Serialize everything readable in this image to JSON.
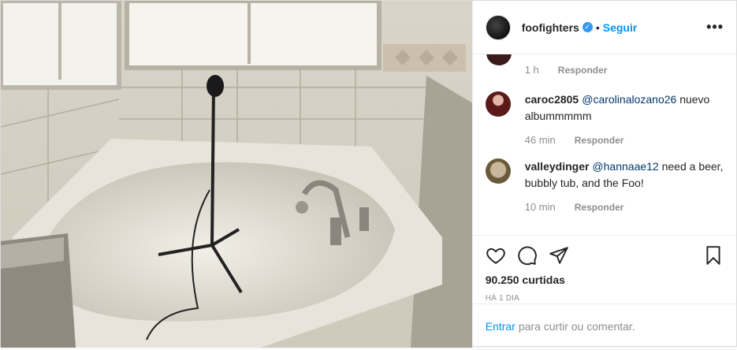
{
  "post": {
    "username": "foofighters",
    "follow_label": "Seguir",
    "dot": "•",
    "more": "•••"
  },
  "comments": {
    "first_time": "1 h",
    "reply_label": "Responder",
    "items": [
      {
        "user": "caroc2805",
        "mention": "@carolinalozano26",
        "text": " nuevo albummmmm",
        "time": "46 min"
      },
      {
        "user": "valleydinger",
        "mention": "@hannaae12",
        "text": " need a beer, bubbly tub, and the Foo!",
        "time": "10 min"
      }
    ]
  },
  "actions": {
    "likes": "90.250 curtidas",
    "time_ago": "HÁ 1 DIA"
  },
  "add_comment": {
    "enter": "Entrar",
    "rest": "para curtir ou comentar."
  },
  "colors": {
    "accent": "#0095f6",
    "muted": "#8e8e8e",
    "verified": "#3897f0"
  },
  "icons": [
    "verified-badge-icon",
    "heart-icon",
    "comment-icon",
    "share-icon",
    "bookmark-icon"
  ]
}
